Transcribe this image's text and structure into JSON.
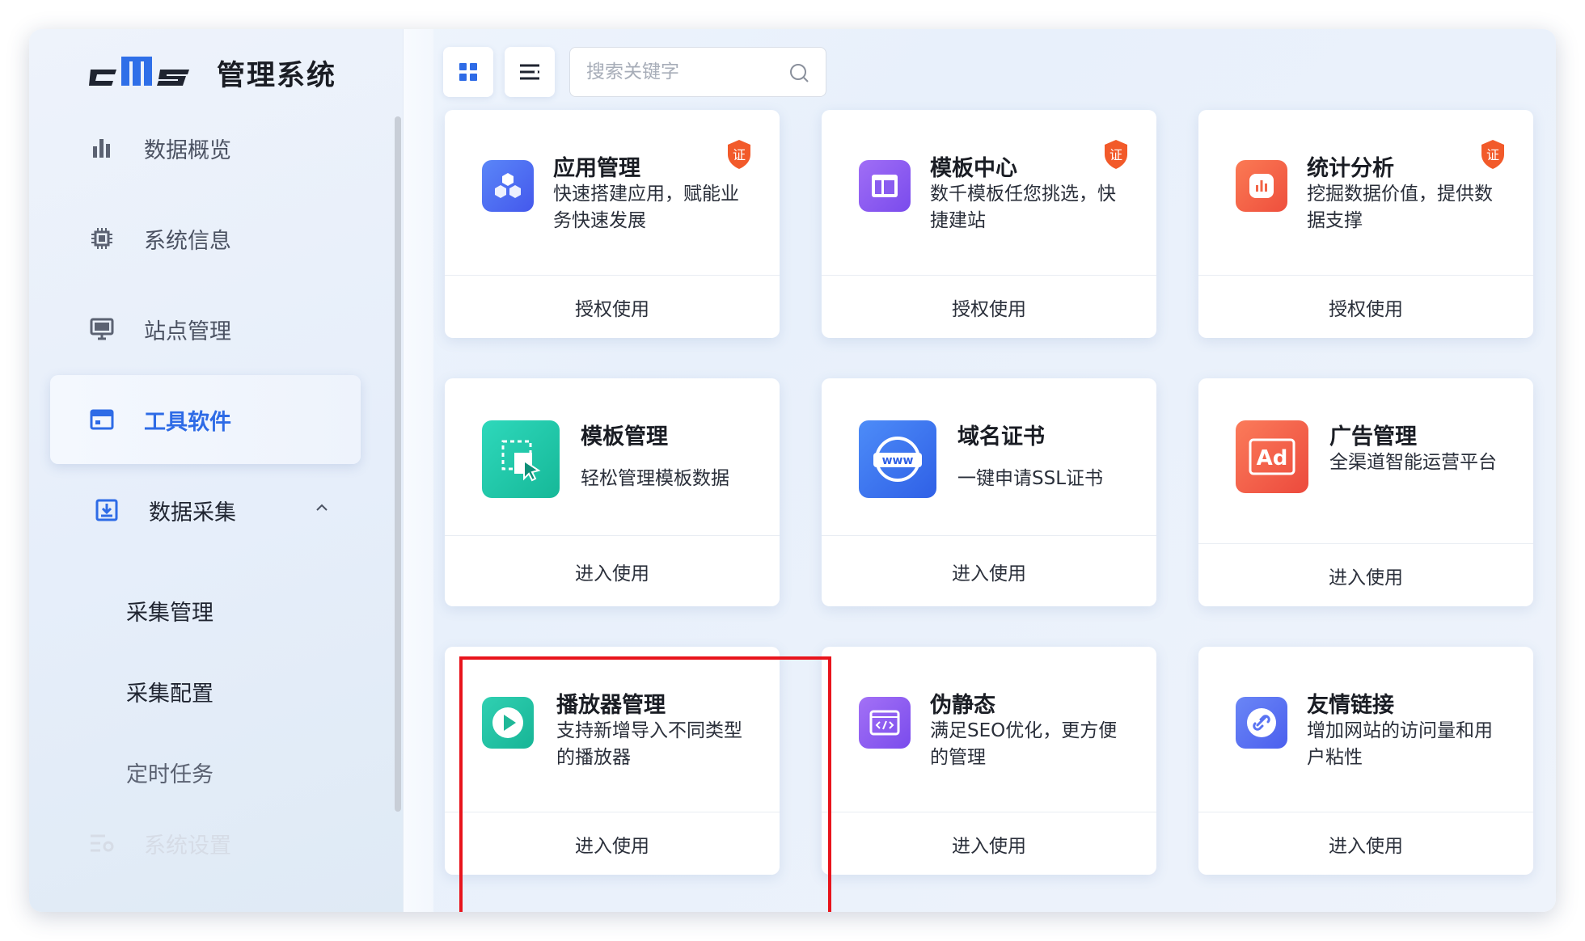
{
  "app": {
    "title": "管理系统",
    "logo_text": "cms"
  },
  "sidebar": {
    "items": [
      {
        "label": "数据概览",
        "icon": "bar-chart-icon"
      },
      {
        "label": "系统信息",
        "icon": "chip-icon"
      },
      {
        "label": "站点管理",
        "icon": "monitor-icon"
      },
      {
        "label": "工具软件",
        "icon": "window-icon",
        "active": true
      },
      {
        "label": "数据采集",
        "icon": "download-box-icon",
        "expanded": true
      },
      {
        "label": "系统设置",
        "icon": "settings-list-icon"
      }
    ],
    "sub_items": [
      {
        "label": "采集管理"
      },
      {
        "label": "采集配置"
      },
      {
        "label": "定时任务"
      }
    ]
  },
  "toolbar": {
    "search_placeholder": "搜索关键字"
  },
  "cards": [
    {
      "title": "应用管理",
      "desc": "快速搭建应用，赋能业务快速发展",
      "action": "授权使用",
      "badge": "证",
      "icon": "cubes-icon",
      "color": "#4f6df5"
    },
    {
      "title": "模板中心",
      "desc": "数千模板任您挑选，快捷建站",
      "action": "授权使用",
      "badge": "证",
      "icon": "layout-icon",
      "color": "#8a5cf0"
    },
    {
      "title": "统计分析",
      "desc": "挖掘数据价值，提供数据支撑",
      "action": "授权使用",
      "badge": "证",
      "icon": "analytics-icon",
      "color": "#f26446"
    },
    {
      "title": "模板管理",
      "desc": "轻松管理模板数据",
      "action": "进入使用",
      "icon": "select-cursor-icon",
      "color": "#1fc6a6"
    },
    {
      "title": "域名证书",
      "desc": "一键申请SSL证书",
      "action": "进入使用",
      "icon": "www-icon",
      "color": "#3a71ee",
      "icon_text": "www"
    },
    {
      "title": "广告管理",
      "desc": "全渠道智能运营平台",
      "action": "进入使用",
      "icon": "ad-icon",
      "color": "#f2604a",
      "icon_text": "Ad"
    },
    {
      "title": "播放器管理",
      "desc": "支持新增导入不同类型的播放器",
      "action": "进入使用",
      "icon": "play-icon",
      "color": "#22c0a4"
    },
    {
      "title": "伪静态",
      "desc": "满足SEO优化，更方便的管理",
      "action": "进入使用",
      "icon": "code-window-icon",
      "color": "#8c5cf0"
    },
    {
      "title": "友情链接",
      "desc": "增加网站的访问量和用户粘性",
      "action": "进入使用",
      "icon": "link-icon",
      "color": "#5a74f2"
    }
  ]
}
